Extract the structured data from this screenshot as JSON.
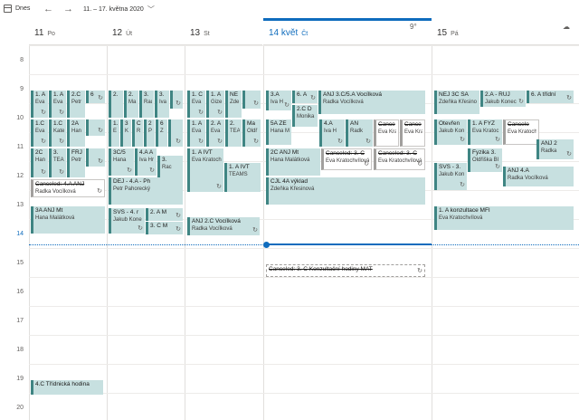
{
  "toolbar": {
    "today_label": "Dnes",
    "back_arrow": "←",
    "forward_arrow": "→",
    "range_label": "11. – 17. května 2020",
    "range_chevron": "﹀",
    "weather_thu": "9°",
    "weather_fri": "☁"
  },
  "days": [
    {
      "num": "11",
      "name": "Po"
    },
    {
      "num": "12",
      "name": "Út"
    },
    {
      "num": "13",
      "name": "St"
    },
    {
      "num": "14 květ",
      "name": "Čt"
    },
    {
      "num": "15",
      "name": "Pá"
    }
  ],
  "hours": [
    "8",
    "9",
    "10",
    "11",
    "12",
    "13",
    "14",
    "15",
    "16",
    "17",
    "18",
    "19",
    "20"
  ],
  "events": [
    {
      "title": "1. A",
      "sub": "Eva",
      "recur": "↻"
    },
    {
      "title": "1. A",
      "sub": "Eva",
      "recur": "↻"
    },
    {
      "title": "2.C",
      "sub": "Petr",
      "recur": ""
    },
    {
      "title": "6",
      "sub": "",
      "recur": "↻"
    },
    {
      "title": "1.C",
      "sub": "Eva",
      "recur": "↻"
    },
    {
      "title": "1.C",
      "sub": "Kate",
      "recur": "↻"
    },
    {
      "title": "2A",
      "sub": "Han",
      "recur": ""
    },
    {
      "title": "",
      "sub": "",
      "recur": "↻"
    },
    {
      "title": "2C",
      "sub": "Han",
      "recur": "↻"
    },
    {
      "title": "3.",
      "sub": "TEA",
      "recur": "↻"
    },
    {
      "title": "FRJ",
      "sub": "Petr",
      "recur": ""
    },
    {
      "title": "",
      "sub": "",
      "recur": "↻"
    },
    {
      "title": "Canceled: 4.A ANJ",
      "sub": "Radka Vocílková",
      "recur": "↻"
    },
    {
      "title": "3A ANJ Mt",
      "sub": "Hana Malátková",
      "recur": ""
    },
    {
      "title": "4.C Třídnická hodina",
      "sub": "",
      "recur": ""
    },
    {
      "title": "2.",
      "sub": "",
      "recur": ""
    },
    {
      "title": "2.",
      "sub": "Ma",
      "recur": ""
    },
    {
      "title": "3.",
      "sub": "Rad",
      "recur": ""
    },
    {
      "title": "3.",
      "sub": "Iva",
      "recur": ""
    },
    {
      "title": "",
      "sub": "",
      "recur": "↻"
    },
    {
      "title": "1.",
      "sub": "E",
      "recur": ""
    },
    {
      "title": "3",
      "sub": "K",
      "recur": ""
    },
    {
      "title": "C",
      "sub": "R",
      "recur": ""
    },
    {
      "title": "2",
      "sub": "P",
      "recur": ""
    },
    {
      "title": "6",
      "sub": "Z",
      "recur": ""
    },
    {
      "title": "",
      "sub": "",
      "recur": "↻"
    },
    {
      "title": "3C/5",
      "sub": "Hana",
      "recur": "↻"
    },
    {
      "title": "4.A A",
      "sub": "Iva Hr",
      "recur": "↻"
    },
    {
      "title": "3.",
      "sub": "Rac",
      "recur": ""
    },
    {
      "title": "DEJ - 4.A - Ph",
      "sub": "Petr Pahorecký",
      "recur": ""
    },
    {
      "title": "SVS - 4. r",
      "sub": "Jakub Kone",
      "recur": "↻"
    },
    {
      "title": "2. A M",
      "sub": "",
      "recur": "↻"
    },
    {
      "title": "3. C M",
      "sub": "",
      "recur": "↻"
    },
    {
      "title": "1. C",
      "sub": "Eva",
      "recur": "↻"
    },
    {
      "title": "1. A",
      "sub": "Gize",
      "recur": "↻"
    },
    {
      "title": "NE",
      "sub": "Zde",
      "recur": ""
    },
    {
      "title": "",
      "sub": "",
      "recur": "↻"
    },
    {
      "title": "1. A",
      "sub": "Eva",
      "recur": "↻"
    },
    {
      "title": "2. A",
      "sub": "Eva",
      "recur": "↻"
    },
    {
      "title": "2.",
      "sub": "TEA",
      "recur": ""
    },
    {
      "title": "Ma",
      "sub": "Oldř",
      "recur": "↻"
    },
    {
      "title": "1. A IVT",
      "sub": "Eva Kratoch",
      "recur": "↻"
    },
    {
      "title": "1. A IVT",
      "sub": "TEAMS",
      "recur": ""
    },
    {
      "title": "ANJ 2.C Vocílková",
      "sub": "Radka Vocílková",
      "recur": "↻"
    },
    {
      "title": "3.A",
      "sub": "Iva H",
      "recur": "↻"
    },
    {
      "title": "6. A",
      "sub": "",
      "recur": "↻"
    },
    {
      "title": "ANJ 3.C/5.A Vocílková",
      "sub": "Radka Vocílková",
      "recur": ""
    },
    {
      "title": "2.C D",
      "sub": "Monika",
      "recur": ""
    },
    {
      "title": "5A ZE",
      "sub": "Hana M",
      "recur": ""
    },
    {
      "title": "4.A",
      "sub": "Iva H",
      "recur": "↻"
    },
    {
      "title": "AN",
      "sub": "Radk",
      "recur": "↻"
    },
    {
      "title": "Cance",
      "sub": "Eva Krat",
      "recur": ""
    },
    {
      "title": "Cance",
      "sub": "Eva Krat",
      "recur": ""
    },
    {
      "title": "2C ANJ Mt",
      "sub": "Hana Malátková",
      "recur": ""
    },
    {
      "title": "Canceled: 3. C",
      "sub": "Eva Kratochvílová",
      "recur": "↻"
    },
    {
      "title": "Canceled: 3. C",
      "sub": "Eva Kratochvílová",
      "recur": "↻"
    },
    {
      "title": "CJL 4A výklad",
      "sub": "Zdeňka Křesinová",
      "recur": ""
    },
    {
      "title": "Canceled: 3. C Konzultační hodiny MAT",
      "sub": "Eva Kratc",
      "recur": "↻"
    },
    {
      "title": "NEJ 3C SA",
      "sub": "Zdeňka Křesino",
      "recur": ""
    },
    {
      "title": "2.A - RUJ",
      "sub": "Jakub Konec",
      "recur": "↻"
    },
    {
      "title": "6. A třídní",
      "sub": "",
      "recur": "↻"
    },
    {
      "title": "Otevřen",
      "sub": "Jakub Kon",
      "recur": "↻"
    },
    {
      "title": "1. A FYZ",
      "sub": "Eva Kratoc",
      "recur": "↻"
    },
    {
      "title": "Cancele",
      "sub": "Eva Kratoch",
      "recur": ""
    },
    {
      "title": "ANJ 2",
      "sub": "Radka",
      "recur": "↻"
    },
    {
      "title": "Fyzika 3.",
      "sub": "Oldřiška Bl",
      "recur": "↻"
    },
    {
      "title": "SVS - 3.",
      "sub": "Jakub Kon",
      "recur": "↻"
    },
    {
      "title": "ANJ 4.A",
      "sub": "Radka Vocílková",
      "recur": ""
    },
    {
      "title": "1. A konzultace MFI",
      "sub": "Eva Kratochvílová",
      "recur": ""
    }
  ]
}
